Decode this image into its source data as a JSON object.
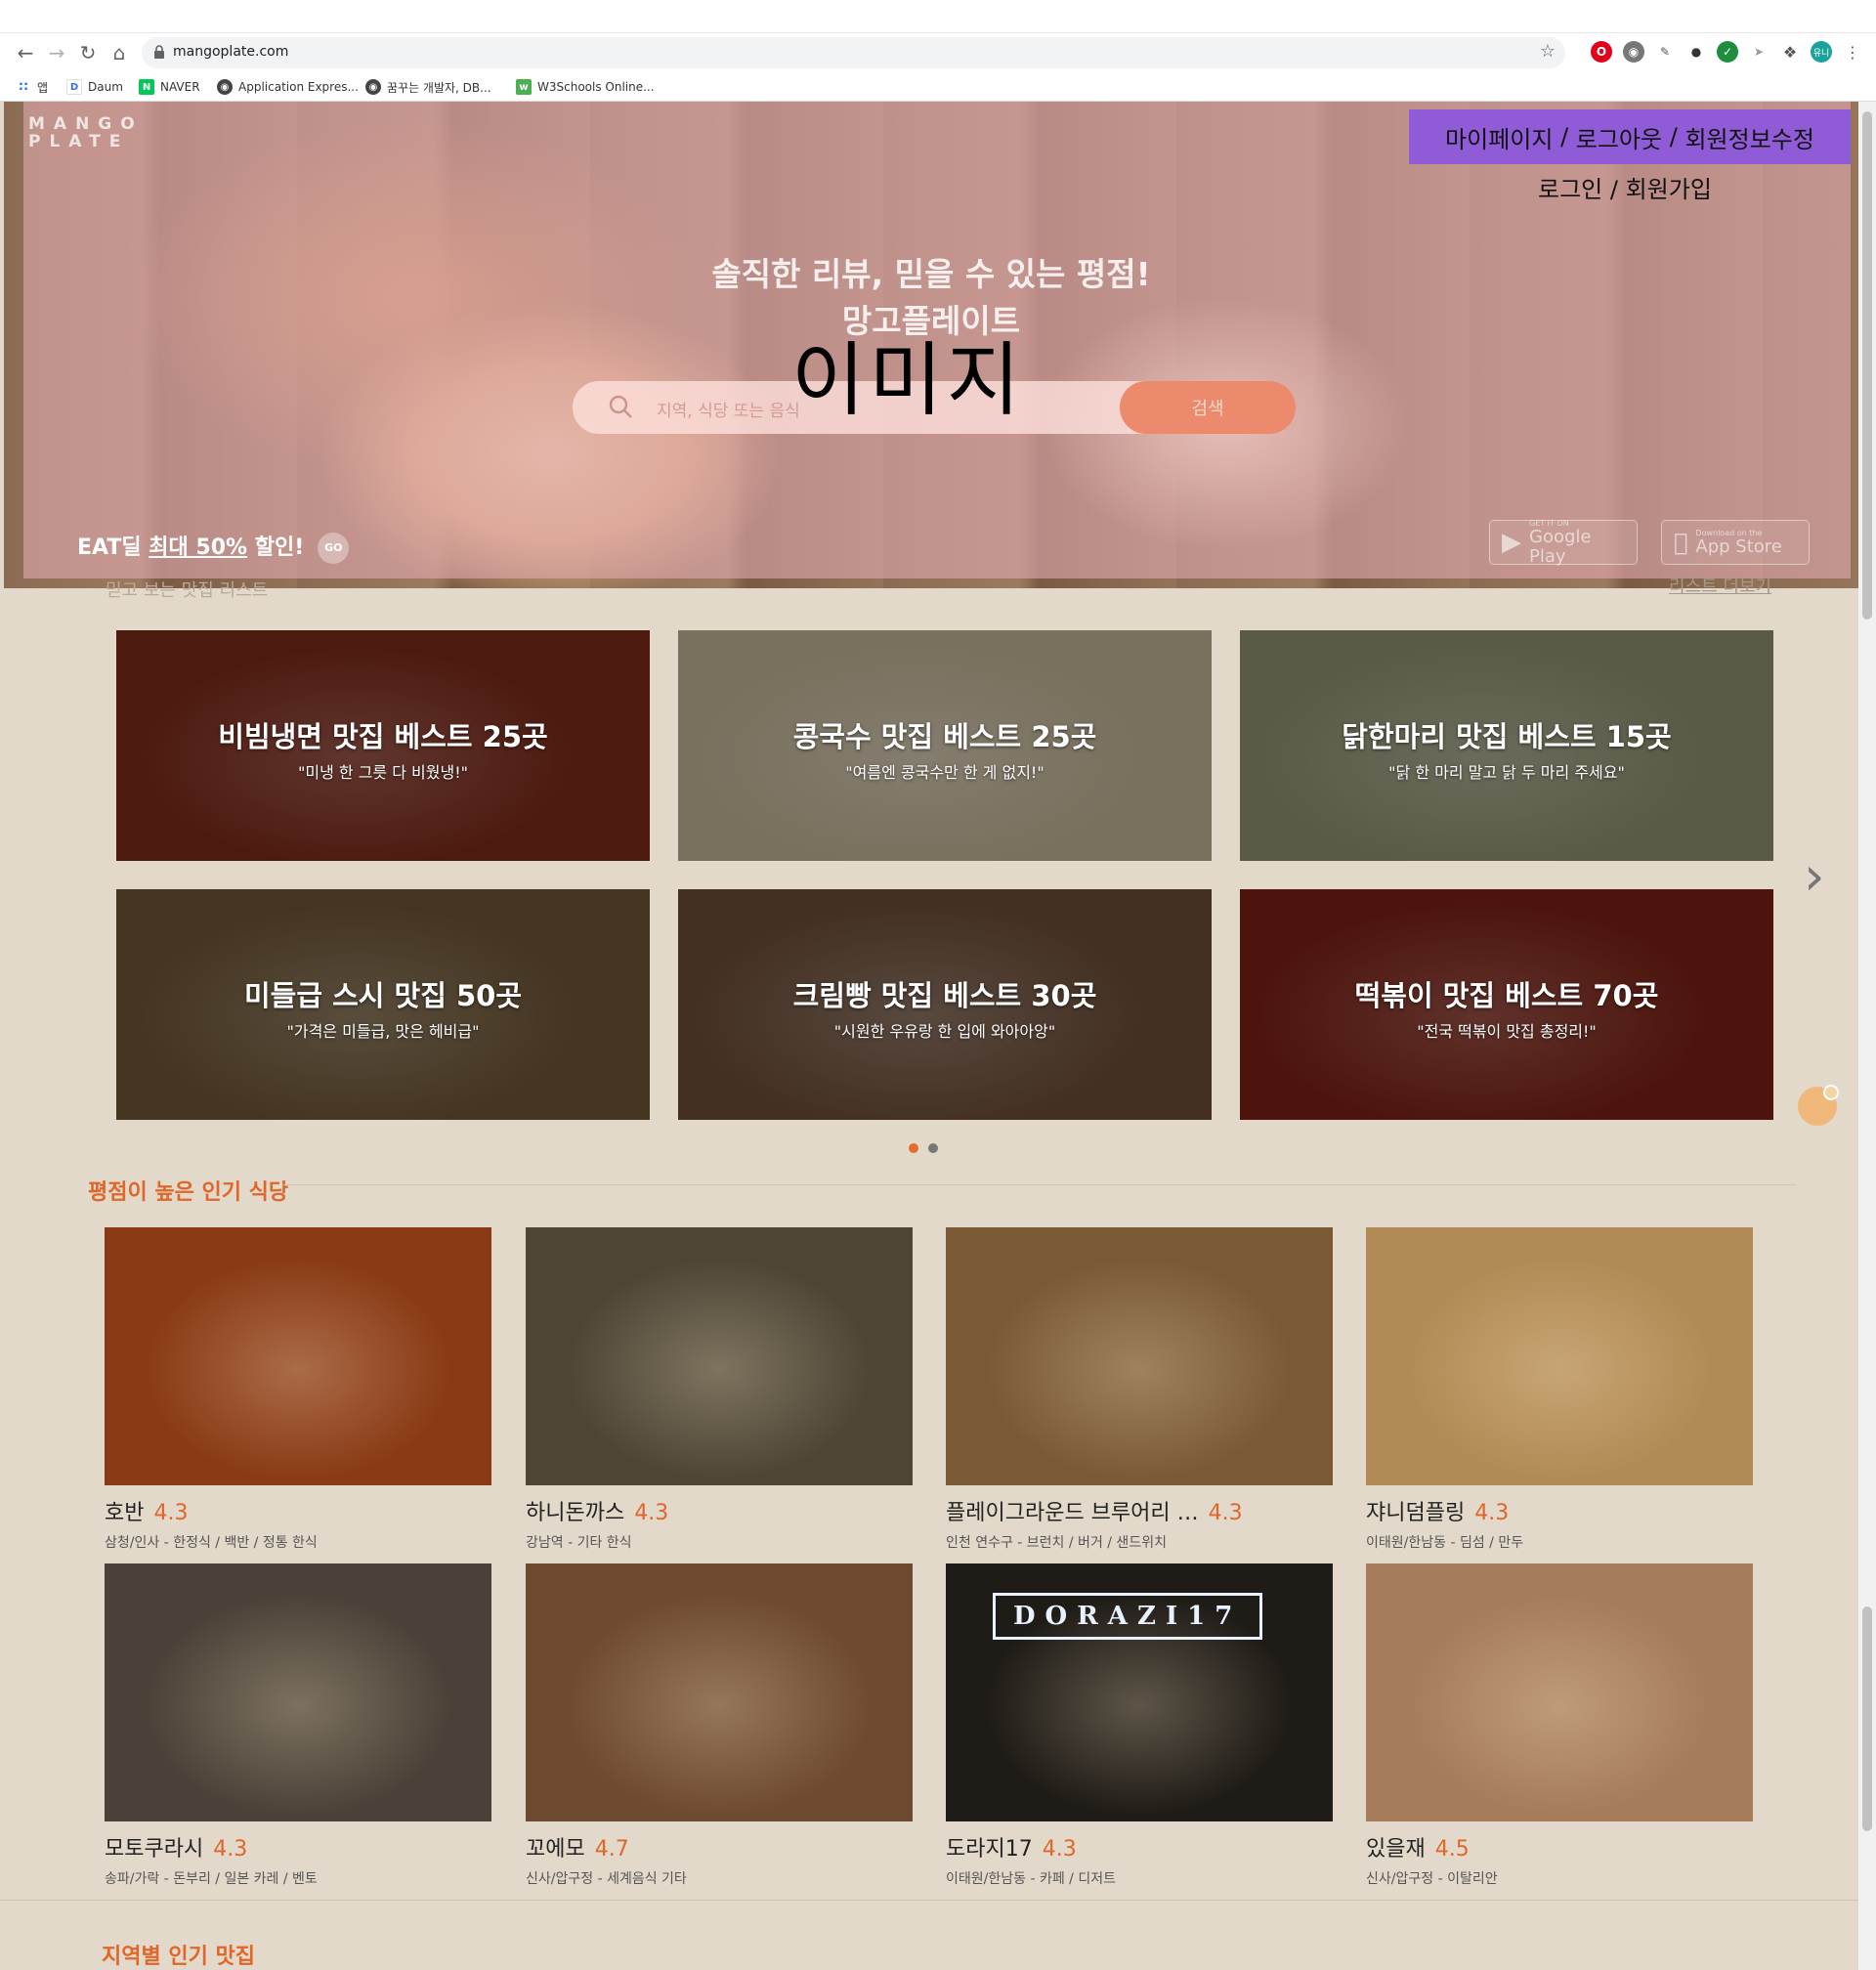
{
  "browser": {
    "url": "mangoplate.com",
    "bookmarks": [
      {
        "label": "앱",
        "icon": "apps-grid-icon"
      },
      {
        "label": "Daum",
        "icon": "daum-icon"
      },
      {
        "label": "NAVER",
        "icon": "naver-icon"
      },
      {
        "label": "Application Expres...",
        "icon": "globe-icon"
      },
      {
        "label": "꿈꾸는 개발자, DB...",
        "icon": "globe-icon"
      },
      {
        "label": "W3Schools Online...",
        "icon": "w3schools-icon"
      }
    ],
    "profile_initials": "유니"
  },
  "hero": {
    "logo_line1": "MANGO",
    "logo_line2": "PLATE",
    "account_links": {
      "mypage": "마이페이지",
      "logout": "로그아웃",
      "edit": "회원정보수정",
      "sep": " / "
    },
    "auth_links": {
      "login": "로그인",
      "signup": "회원가입",
      "sep": " / "
    },
    "tagline1": "솔직한 리뷰, 믿을 수 있는 평점!",
    "tagline2": "망고플레이트",
    "image_placeholder": "이미지",
    "search_placeholder": "지역, 식당 또는 음식",
    "search_button": "검색",
    "eat_prefix": "EAT딜 ",
    "eat_highlight": "최대 50%",
    "eat_suffix": " 할인!",
    "go_label": "GO",
    "google_play": {
      "small": "GET IT ON",
      "big": "Google Play"
    },
    "app_store": {
      "small": "Download on the",
      "big": "App Store"
    }
  },
  "lists": {
    "title": "믿고 보는 맛집 리스트",
    "more": "리스트 더보기",
    "cards": [
      {
        "title": "비빔냉면 맛집 베스트 25곳",
        "subtitle": "\"미냉 한 그릇 다 비웠냉!\"",
        "color": "#6b2416"
      },
      {
        "title": "콩국수 맛집 베스트 25곳",
        "subtitle": "\"여름엔 콩국수만 한 게 없지!\"",
        "color": "#a89c82"
      },
      {
        "title": "닭한마리 맛집 베스트 15곳",
        "subtitle": "\"닭 한 마리 말고 닭 두 마리 주세요\"",
        "color": "#7d7d62"
      },
      {
        "title": "미들급 스시 맛집 50곳",
        "subtitle": "\"가격은 미들급, 맛은 헤비급\"",
        "color": "#5f4a2e"
      },
      {
        "title": "크림빵 맛집 베스트 30곳",
        "subtitle": "\"시원한 우유랑 한 입에 와아아앙\"",
        "color": "#5e4331"
      },
      {
        "title": "떡볶이 맛집 베스트 70곳",
        "subtitle": "\"전국 떡볶이 맛집 총정리!\"",
        "color": "#6a1d12"
      }
    ],
    "page_count": 2,
    "active_page": 1
  },
  "popular": {
    "title": "평점이 높은 인기 식당",
    "restaurants": [
      {
        "name": "호반",
        "score": "4.3",
        "meta": "삼청/인사 - 한정식 / 백반 / 정통 한식",
        "color": "#8a3a16"
      },
      {
        "name": "하니돈까스",
        "score": "4.3",
        "meta": "강남역 - 기타 한식",
        "color": "#4d4536"
      },
      {
        "name": "플레이그라운드 브루어리 …",
        "score": "4.3",
        "meta": "인천 연수구 - 브런치 / 버거 / 샌드위치",
        "color": "#7a5a34"
      },
      {
        "name": "쟈니덤플링",
        "score": "4.3",
        "meta": "이태원/한남동 - 딤섬 / 만두",
        "color": "#b28a55"
      },
      {
        "name": "모토쿠라시",
        "score": "4.3",
        "meta": "송파/가락 - 돈부리 / 일본 카레 / 벤토",
        "color": "#4a4238"
      },
      {
        "name": "꼬에모",
        "score": "4.7",
        "meta": "신사/압구정 - 세계음식 기타",
        "color": "#6e4a30"
      },
      {
        "name": "도라지17",
        "score": "4.3",
        "meta": "이태원/한남동 - 카페 / 디저트",
        "color": "#1f1b16",
        "sign": "DORAZI17"
      },
      {
        "name": "있을재",
        "score": "4.5",
        "meta": "신사/압구정 - 이탈리안",
        "color": "#a67c5a"
      }
    ]
  },
  "region": {
    "title": "지역별 인기 맛집"
  }
}
